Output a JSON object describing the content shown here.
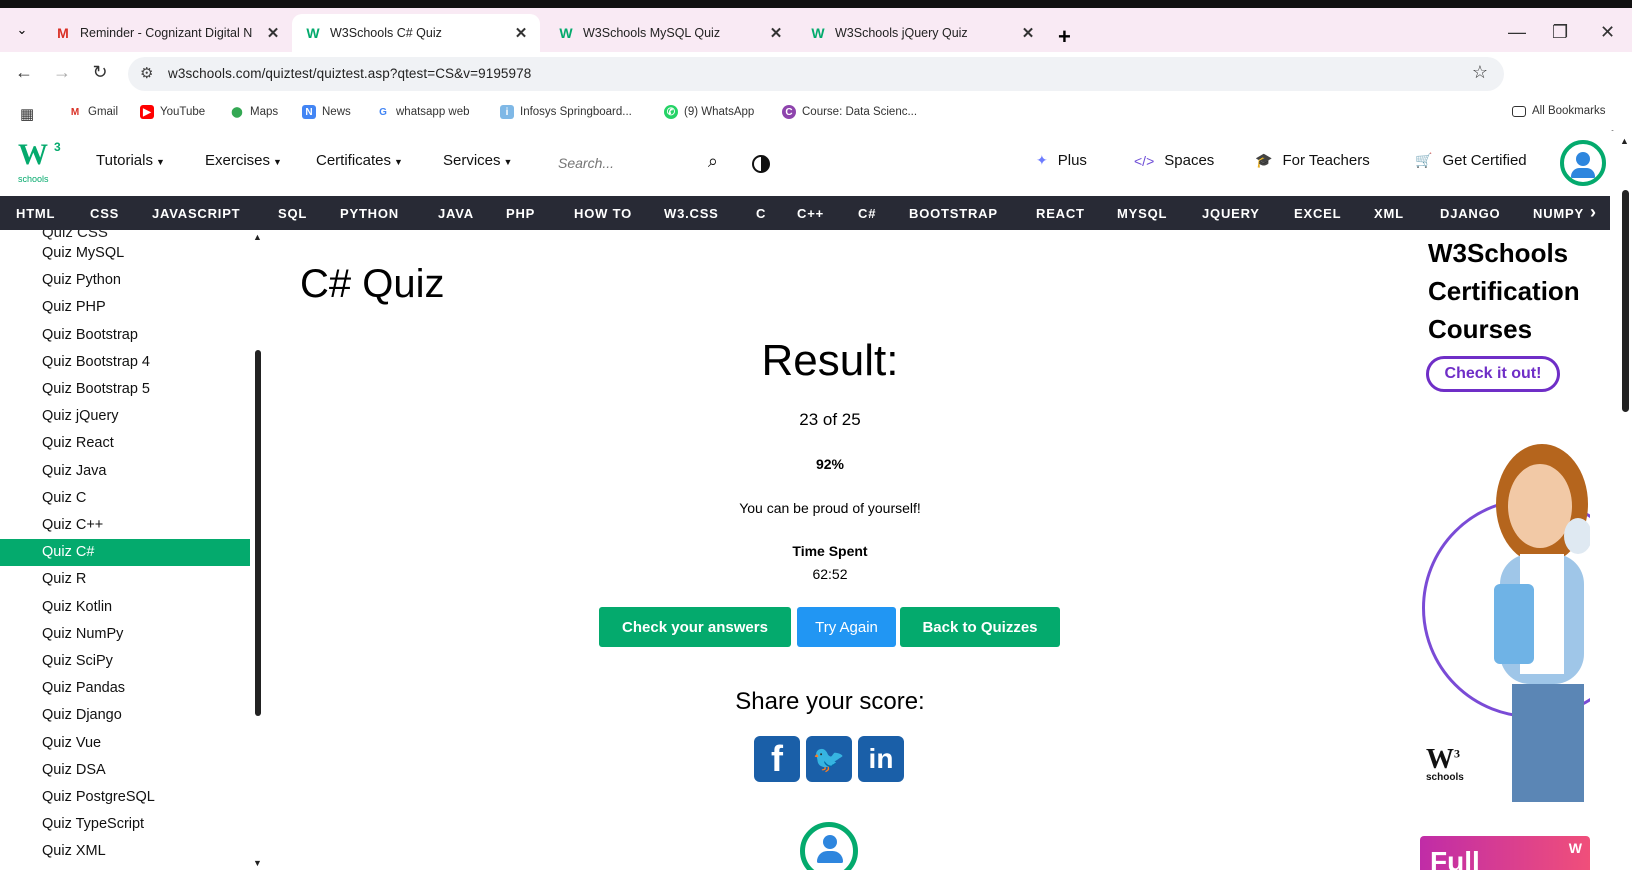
{
  "browser": {
    "tabs": [
      {
        "title": "Reminder - Cognizant Digital N",
        "favicon": "gmail-icon"
      },
      {
        "title": "W3Schools C# Quiz",
        "favicon": "w3schools-icon"
      },
      {
        "title": "W3Schools MySQL Quiz",
        "favicon": "w3schools-icon"
      },
      {
        "title": "W3Schools jQuery Quiz",
        "favicon": "w3schools-icon"
      }
    ],
    "url": "w3schools.com/quiztest/quiztest.asp?qtest=CS&v=9195978",
    "bookmarks": [
      "Gmail",
      "YouTube",
      "Maps",
      "News",
      "whatsapp web",
      "Infosys Springboard...",
      "(9) WhatsApp",
      "Course: Data Scienc..."
    ],
    "all_bookmarks": "All Bookmarks"
  },
  "header": {
    "logo_small": "schools",
    "logo_sup": "3",
    "logo_big": "W",
    "nav": [
      "Tutorials",
      "Exercises",
      "Certificates",
      "Services"
    ],
    "search_placeholder": "Search...",
    "right_nav": [
      "Plus",
      "Spaces",
      "For Teachers",
      "Get Certified"
    ]
  },
  "topics": [
    "HTML",
    "CSS",
    "JAVASCRIPT",
    "SQL",
    "PYTHON",
    "JAVA",
    "PHP",
    "HOW TO",
    "W3.CSS",
    "C",
    "C++",
    "C#",
    "BOOTSTRAP",
    "REACT",
    "MYSQL",
    "JQUERY",
    "EXCEL",
    "XML",
    "DJANGO",
    "NUMPY"
  ],
  "sidebar": {
    "cut_item": "Quiz CSS",
    "items": [
      "Quiz MySQL",
      "Quiz Python",
      "Quiz PHP",
      "Quiz Bootstrap",
      "Quiz Bootstrap 4",
      "Quiz Bootstrap 5",
      "Quiz jQuery",
      "Quiz React",
      "Quiz Java",
      "Quiz C",
      "Quiz C++",
      "Quiz C#",
      "Quiz R",
      "Quiz Kotlin",
      "Quiz NumPy",
      "Quiz SciPy",
      "Quiz Pandas",
      "Quiz Django",
      "Quiz Vue",
      "Quiz DSA",
      "Quiz PostgreSQL",
      "Quiz TypeScript",
      "Quiz XML"
    ],
    "active_index": 11
  },
  "main": {
    "title": "C# Quiz",
    "result_heading": "Result:",
    "score": "23 of 25",
    "percent": "92%",
    "message": "You can be proud of yourself!",
    "time_label": "Time Spent",
    "time_value": "62:52",
    "buttons": {
      "check": "Check your answers",
      "retry": "Try Again",
      "back": "Back to Quizzes"
    },
    "share_label": "Share your score:"
  },
  "ad": {
    "title": "W3Schools Certification Courses",
    "cta": "Check it out!",
    "logo_small": "schools",
    "logo_sup": "3",
    "logo_big": "W",
    "bottom_text": "Full"
  },
  "colors": {
    "brand_green": "#04aa6d",
    "topic_bar": "#282a35",
    "retry_blue": "#2196f3",
    "social_blue": "#1a5fa8",
    "ad_purple": "#6f2ec7"
  }
}
